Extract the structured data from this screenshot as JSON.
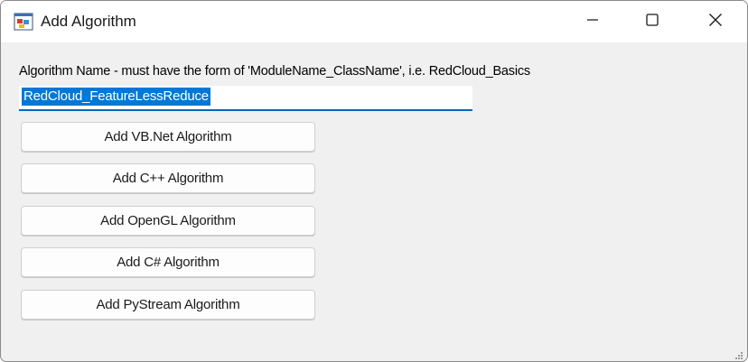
{
  "window": {
    "title": "Add Algorithm",
    "icon": "app-window-icon",
    "controls": [
      "minimize-icon",
      "maximize-icon",
      "close-icon"
    ]
  },
  "form": {
    "prompt": "Algorithm Name - must have the form of 'ModuleName_ClassName', i.e. RedCloud_Basics",
    "algorithm_name_value": "RedCloud_FeatureLessReduce",
    "buttons": {
      "vbnet": "Add VB.Net Algorithm",
      "cpp": "Add C++ Algorithm",
      "opengl": "Add OpenGL Algorithm",
      "csharp": "Add C# Algorithm",
      "pystream": "Add PyStream Algorithm"
    }
  },
  "colors": {
    "accent": "#0067c0",
    "selection": "#0078d7",
    "background": "#f0f0f0"
  }
}
